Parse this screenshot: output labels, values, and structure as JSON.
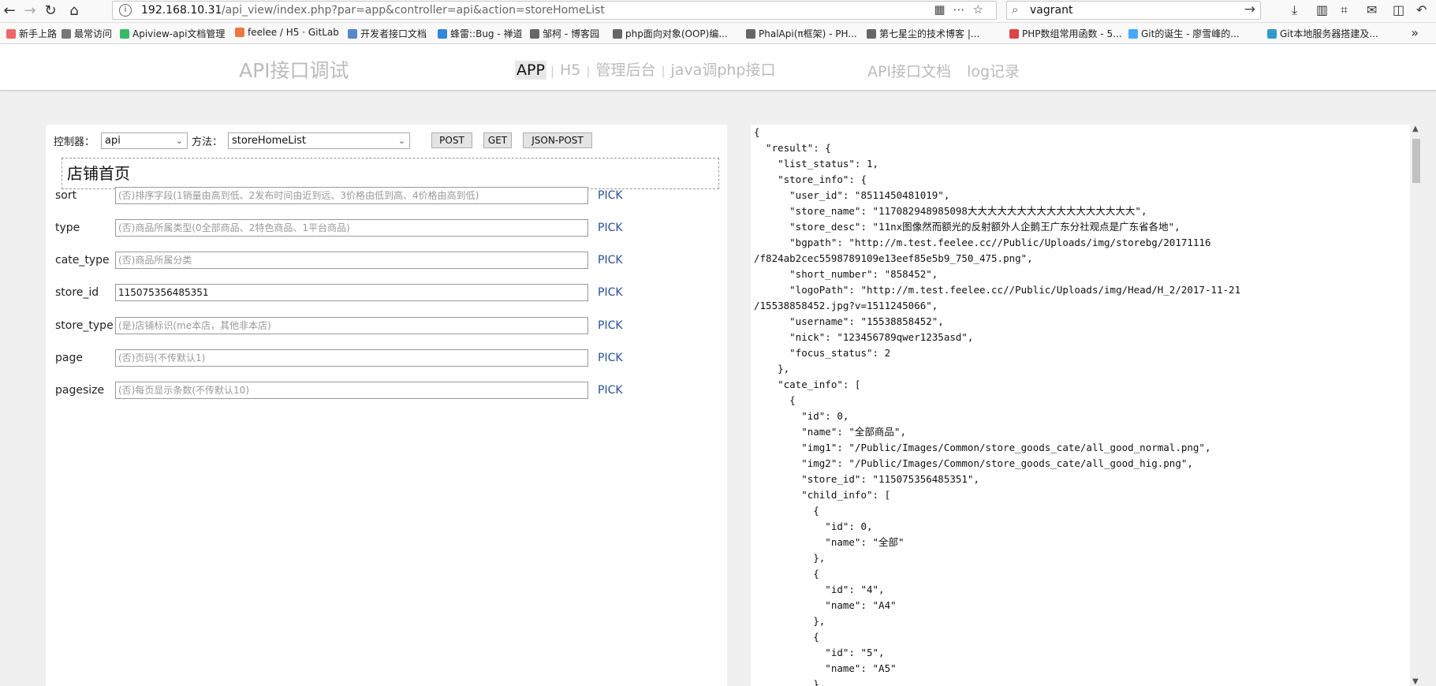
{
  "browser": {
    "url_host": "192.168.10.31",
    "url_path": "/api_view/index.php?par=app&controller=api&action=storeHomeList",
    "search_value": "vagrant",
    "bookmarks": [
      "新手上路",
      "最常访问",
      "Apiview-api文档管理",
      "feelee / H5 · GitLab",
      "开发者接口文档",
      "蜂雷::Bug - 禅道",
      "邹柯 - 博客园",
      "php面向对象(OOP)编...",
      "PhalApi(π框架) - PH...",
      "第七星尘的技术博客 |...",
      "PHP数组常用函数 - 5...",
      "Git的诞生 - 廖雪峰的...",
      "Git本地服务器搭建及..."
    ]
  },
  "header": {
    "title": "API接口调试",
    "tabs": [
      "APP",
      "H5",
      "管理后台",
      "java调php接口"
    ],
    "active_tab": "APP",
    "links": [
      "API接口文档",
      "log记录"
    ]
  },
  "form": {
    "controller_label": "控制器：",
    "controller_value": "api",
    "method_label": "方法：",
    "method_value": "storeHomeList",
    "buttons": [
      "POST",
      "GET",
      "JSON-POST"
    ],
    "doc_title": "店铺首页",
    "pick_label": "PICK",
    "params": [
      {
        "name": "sort",
        "value": "",
        "placeholder": "(否)排序字段(1销量由高到低、2发布时间由近到远、3价格由低到高、4价格由高到低)"
      },
      {
        "name": "type",
        "value": "",
        "placeholder": "(否)商品所属类型(0全部商品、2特色商品、1平台商品)"
      },
      {
        "name": "cate_type",
        "value": "",
        "placeholder": "(否)商品所属分类"
      },
      {
        "name": "store_id",
        "value": "115075356485351",
        "placeholder": ""
      },
      {
        "name": "store_type",
        "value": "",
        "placeholder": "(是)店铺标识(me本店，其他非本店)"
      },
      {
        "name": "page",
        "value": "",
        "placeholder": "(否)页码(不传默认1)"
      },
      {
        "name": "pagesize",
        "value": "",
        "placeholder": "(否)每页显示条数(不传默认10)"
      }
    ]
  },
  "response_lines": [
    "{",
    "  \"result\": {",
    "    \"list_status\": 1,",
    "    \"store_info\": {",
    "      \"user_id\": \"8511450481019\",",
    "      \"store_name\": \"117082948985098大大大大大大大大大大大大大大大大大\",",
    "      \"store_desc\": \"11nx图像然而额光的反射额外人企鹅王广东分社观点是广东省各地\",",
    "      \"bgpath\": \"http://m.test.feelee.cc//Public/Uploads/img/storebg/20171116",
    "/f824ab2cec5598789109e13eef85e5b9_750_475.png\",",
    "      \"short_number\": \"858452\",",
    "      \"logoPath\": \"http://m.test.feelee.cc//Public/Uploads/img/Head/H_2/2017-11-21",
    "/15538858452.jpg?v=1511245066\",",
    "      \"username\": \"15538858452\",",
    "      \"nick\": \"123456789qwer1235asd\",",
    "      \"focus_status\": 2",
    "    },",
    "    \"cate_info\": [",
    "      {",
    "        \"id\": 0,",
    "        \"name\": \"全部商品\",",
    "        \"img1\": \"/Public/Images/Common/store_goods_cate/all_good_normal.png\",",
    "        \"img2\": \"/Public/Images/Common/store_goods_cate/all_good_hig.png\",",
    "        \"store_id\": \"115075356485351\",",
    "        \"child_info\": [",
    "          {",
    "            \"id\": 0,",
    "            \"name\": \"全部\"",
    "          },",
    "          {",
    "            \"id\": \"4\",",
    "            \"name\": \"A4\"",
    "          },",
    "          {",
    "            \"id\": \"5\",",
    "            \"name\": \"A5\"",
    "          },"
  ]
}
